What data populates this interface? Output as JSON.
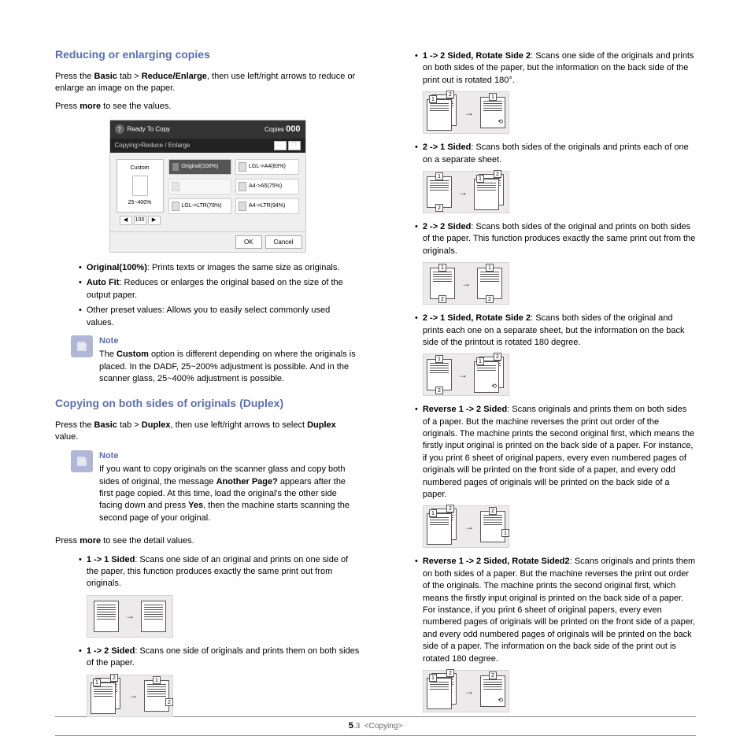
{
  "leftCol": {
    "h1": "Reducing or enlarging copies",
    "p1a": "Press the ",
    "p1b": "Basic",
    "p1c": " tab > ",
    "p1d": "Reduce/Enlarge",
    "p1e": ", then use left/right arrows to reduce or enlarge an image on the paper.",
    "p2a": "Press ",
    "p2b": "more",
    "p2c": " to see the values.",
    "ui": {
      "headerLeft": "Ready To Copy",
      "copiesLabel": "Copies",
      "copiesVal": "000",
      "breadcrumb": "Copying>Reduce / Enlarge",
      "custom": "Custom",
      "customRange": "25~400%",
      "row1a": "Original(100%)",
      "row1b": "LGL->A4(83%)",
      "row2a": "",
      "row2b": "A4->A5(75%)",
      "row3a": "LGL->LTR(78%)",
      "row3b": "A4->LTR(94%)",
      "ok": "OK",
      "cancel": "Cancel"
    },
    "b1a": "Original(100%)",
    "b1b": ": Prints texts or images the same size as originals.",
    "b2a": "Auto Fit",
    "b2b": ": Reduces or enlarges the original based on the size of the output paper.",
    "b3": "Other preset values: Allows you to easily select commonly used values.",
    "note1Title": "Note",
    "note1a": "The ",
    "note1b": "Custom",
    "note1c": " option is different depending on where the originals is placed. In the DADF, 25~200% adjustment is possible. And in the scanner glass, 25~400% adjustment is possible.",
    "h2": "Copying on both sides of originals (Duplex)",
    "p3a": "Press the ",
    "p3b": "Basic",
    "p3c": " tab > ",
    "p3d": "Duplex",
    "p3e": ", then use left/right arrows to select ",
    "p3f": "Duplex",
    "p3g": " value.",
    "note2Title": "Note",
    "note2a": "If you want to copy originals on the scanner glass and copy both sides of original, the message ",
    "note2b": "Another Page?",
    "note2c": " appears after the first page copied. At this time, load the original's the other side facing down and press ",
    "note2d": "Yes",
    "note2e": ", then the machine starts scanning the second page of your original.",
    "p4a": "Press ",
    "p4b": "more",
    "p4c": " to see the detail values.",
    "b4a": "1 -> 1 Sided",
    "b4b": ": Scans one side of an original and prints on one side of the paper, this function produces exactly the same print out from originals.",
    "b5a": "1 -> 2 Sided",
    "b5b": ": Scans one side of originals and prints them on both sides of the paper."
  },
  "rightCol": {
    "b1a": "1 -> 2 Sided, Rotate Side 2",
    "b1b": ": Scans one side of the originals and prints on both sides of the paper, but the information on the back side of the print out is rotated 180°.",
    "b2a": "2 -> 1 Sided",
    "b2b": ": Scans both sides of the originals and prints each of one on a separate sheet.",
    "b3a": "2 -> 2 Sided",
    "b3b": ": Scans both sides of the original and prints on both sides of the paper. This function produces exactly the same print out from the originals.",
    "b4a": "2 -> 1 Sided, Rotate Side 2",
    "b4b": ": Scans both sides of the original and prints each one on a separate sheet, but the information on the back side of the printout is rotated 180 degree.",
    "b5a": "Reverse 1 -> 2 Sided",
    "b5b": ": Scans originals and prints them on both sides of a paper. But the machine reverses the print out order of the originals. The machine prints the second original first, which means the firstly input original is printed on the back side of a paper. For instance, if you print 6 sheet of original papers, every even numbered pages of originals will be printed on the front side of a paper, and every odd numbered pages of originals will be printed on the back side of a paper.",
    "b6a": "Reverse 1 -> 2 Sided, Rotate Sided2",
    "b6b": ": Scans originals and prints them on both sides of a paper. But the machine reverses the print out order of the originals. The machine prints the second original first, which means the firstly input original is printed on the back side of a paper. For instance, if you print 6 sheet of original papers, every even numbered pages of originals will be printed on the front side of a paper, and every odd numbered pages of originals will be printed on the back side of a paper. The information on the back side of the print out is rotated 180 degree."
  },
  "footer": {
    "chapter": "5",
    "page": ".3",
    "section": "<Copying>"
  }
}
